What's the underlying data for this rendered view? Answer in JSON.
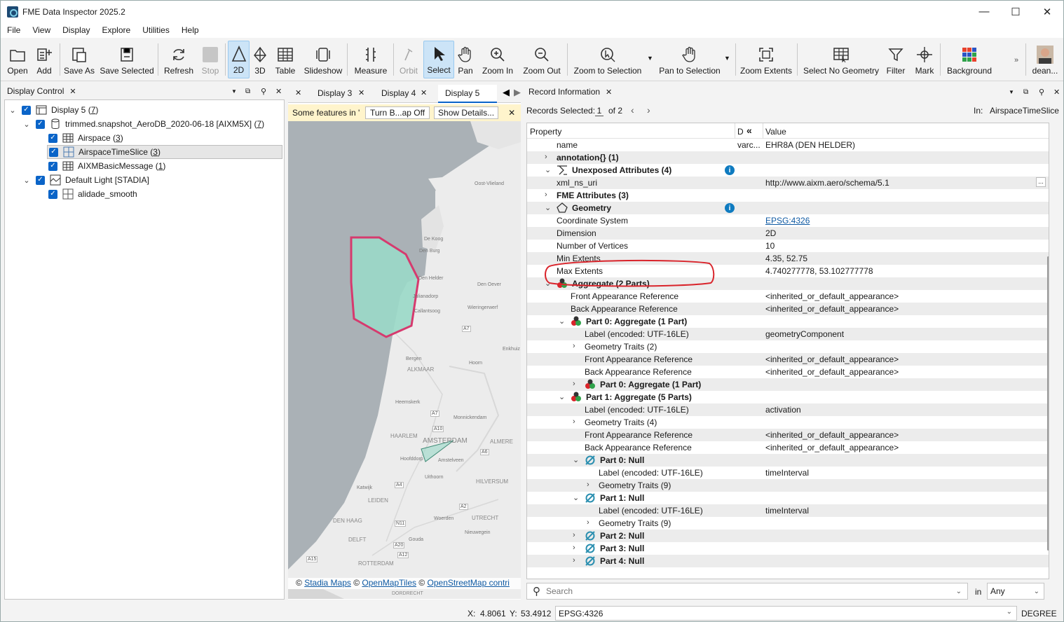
{
  "window": {
    "title": "FME Data Inspector 2025.2",
    "min": "—",
    "max": "☐",
    "close": "✕"
  },
  "menu": [
    "File",
    "View",
    "Display",
    "Explore",
    "Utilities",
    "Help"
  ],
  "toolbar": {
    "open": "Open",
    "add": "Add",
    "save_as": "Save As",
    "save_selected": "Save Selected",
    "refresh": "Refresh",
    "stop": "Stop",
    "two_d": "2D",
    "three_d": "3D",
    "table": "Table",
    "slideshow": "Slideshow",
    "measure": "Measure",
    "orbit": "Orbit",
    "select": "Select",
    "pan": "Pan",
    "zoom_in": "Zoom In",
    "zoom_out": "Zoom Out",
    "zoom_to_selection": "Zoom to Selection",
    "pan_to_selection": "Pan to Selection",
    "zoom_extents": "Zoom Extents",
    "select_no_geometry": "Select No Geometry",
    "filter": "Filter",
    "mark": "Mark",
    "background": "Background",
    "user": "dean..."
  },
  "display_control": {
    "title": "Display Control",
    "items": [
      {
        "label": "Display 5 (",
        "count": "7",
        "suffix": ")"
      },
      {
        "label": "trimmed.snapshot_AeroDB_2020-06-18 [AIXM5X] (",
        "count": "7",
        "suffix": ")"
      },
      {
        "label": "Airspace (",
        "count": "3",
        "suffix": ")"
      },
      {
        "label": "AirspaceTimeSlice (",
        "count": "3",
        "suffix": ")"
      },
      {
        "label": "AIXMBasicMessage (",
        "count": "1",
        "suffix": ")"
      },
      {
        "label": "Default Light [STADIA]",
        "count": "",
        "suffix": ""
      },
      {
        "label": "alidade_smooth",
        "count": "",
        "suffix": ""
      }
    ]
  },
  "map_panel": {
    "tabs": [
      "Display 3",
      "Display 4",
      "Display 5"
    ],
    "notice": "Some features in '",
    "turn_off": "Turn B...ap Off",
    "show_details": "Show Details...",
    "attribution": {
      "c1": "©",
      "stadia": "Stadia Maps",
      "c2": "©",
      "omt": "OpenMapTiles",
      "c3": "©",
      "osm": "OpenStreetMap contri"
    },
    "places": [
      "Oost-Vlieland",
      "De Koog",
      "Den Burg",
      "Den Helder",
      "Den Oever",
      "Julianadorp",
      "Callantsoog",
      "Wieringerwerf",
      "A7",
      "Enkhuiz",
      "Bergen",
      "ALKMAAR",
      "Hoorn",
      "Heemskerk",
      "A7",
      "Monnickendam",
      "A10",
      "HAARLEM",
      "AMSTERDAM",
      "ALMERE",
      "Hoofddorp",
      "Amstelveen",
      "A6",
      "Uithoorn",
      "A4",
      "Katwijk",
      "LEIDEN",
      "HILVERSUM",
      "A2",
      "DEN HAAG",
      "N11",
      "UTRECHT",
      "Woerden",
      "Nieuwegein",
      "DELFT",
      "A20",
      "Gouda",
      "A15",
      "A12",
      "ROTTERDAM",
      "DORDRECHT"
    ]
  },
  "record_info": {
    "title": "Record Information",
    "records_selected_label": "Records Selected:",
    "records_selected_value": "1",
    "of_total": "of 2",
    "in_label": "In:",
    "in_value": "AirspaceTimeSlice",
    "col_property": "Property",
    "col_d": "D",
    "col_value": "Value",
    "rows": [
      {
        "indent": 0,
        "exp": "",
        "icon": "",
        "label": "name",
        "d": "varc...",
        "value": "EHR8A (DEN HELDER)",
        "bold": false
      },
      {
        "indent": 0,
        "exp": ">",
        "icon": "",
        "label": "annotation{} (1)",
        "d": "",
        "value": "",
        "bold": true
      },
      {
        "indent": 0,
        "exp": "v",
        "icon": "attrs",
        "label": "Unexposed Attributes (4)",
        "d": "",
        "value": "",
        "bold": true,
        "info": true
      },
      {
        "indent": 0,
        "exp": "",
        "icon": "",
        "label": "xml_ns_uri",
        "d": "",
        "value": "http://www.aixm.aero/schema/5.1",
        "bold": false,
        "more": true
      },
      {
        "indent": 0,
        "exp": ">",
        "icon": "",
        "label": "FME Attributes (3)",
        "d": "",
        "value": "",
        "bold": true
      },
      {
        "indent": 0,
        "exp": "v",
        "icon": "geom",
        "label": "Geometry",
        "d": "",
        "value": "",
        "bold": true,
        "info": true
      },
      {
        "indent": 0,
        "exp": "",
        "icon": "",
        "label": "Coordinate System",
        "d": "",
        "value": "EPSG:4326",
        "bold": false,
        "link": true
      },
      {
        "indent": 0,
        "exp": "",
        "icon": "",
        "label": "Dimension",
        "d": "",
        "value": "2D",
        "bold": false
      },
      {
        "indent": 0,
        "exp": "",
        "icon": "",
        "label": "Number of Vertices",
        "d": "",
        "value": "10",
        "bold": false
      },
      {
        "indent": 0,
        "exp": "",
        "icon": "",
        "label": "Min Extents",
        "d": "",
        "value": "4.35, 52.75",
        "bold": false
      },
      {
        "indent": 0,
        "exp": "",
        "icon": "",
        "label": "Max Extents",
        "d": "",
        "value": "4.740277778, 53.102777778",
        "bold": false
      },
      {
        "indent": 0,
        "exp": "v",
        "icon": "agg",
        "label": "Aggregate (2 Parts)",
        "d": "",
        "value": "",
        "bold": true
      },
      {
        "indent": 1,
        "exp": "",
        "icon": "",
        "label": "Front Appearance Reference",
        "d": "",
        "value": "<inherited_or_default_appearance>",
        "bold": false
      },
      {
        "indent": 1,
        "exp": "",
        "icon": "",
        "label": "Back Appearance Reference",
        "d": "",
        "value": "<inherited_or_default_appearance>",
        "bold": false
      },
      {
        "indent": 1,
        "exp": "v",
        "icon": "agg",
        "label": "Part 0: Aggregate (1 Part)",
        "d": "",
        "value": "",
        "bold": true
      },
      {
        "indent": 2,
        "exp": "",
        "icon": "",
        "label": "Label (encoded: UTF-16LE)",
        "d": "",
        "value": "geometryComponent",
        "bold": false
      },
      {
        "indent": 2,
        "exp": ">",
        "icon": "",
        "label": "Geometry Traits (2)",
        "d": "",
        "value": "",
        "bold": false
      },
      {
        "indent": 2,
        "exp": "",
        "icon": "",
        "label": "Front Appearance Reference",
        "d": "",
        "value": "<inherited_or_default_appearance>",
        "bold": false
      },
      {
        "indent": 2,
        "exp": "",
        "icon": "",
        "label": "Back Appearance Reference",
        "d": "",
        "value": "<inherited_or_default_appearance>",
        "bold": false
      },
      {
        "indent": 2,
        "exp": ">",
        "icon": "agg",
        "label": "Part 0: Aggregate (1 Part)",
        "d": "",
        "value": "",
        "bold": true
      },
      {
        "indent": 1,
        "exp": "v",
        "icon": "agg",
        "label": "Part 1: Aggregate (5 Parts)",
        "d": "",
        "value": "",
        "bold": true
      },
      {
        "indent": 2,
        "exp": "",
        "icon": "",
        "label": "Label (encoded: UTF-16LE)",
        "d": "",
        "value": "activation",
        "bold": false
      },
      {
        "indent": 2,
        "exp": ">",
        "icon": "",
        "label": "Geometry Traits (4)",
        "d": "",
        "value": "",
        "bold": false
      },
      {
        "indent": 2,
        "exp": "",
        "icon": "",
        "label": "Front Appearance Reference",
        "d": "",
        "value": "<inherited_or_default_appearance>",
        "bold": false
      },
      {
        "indent": 2,
        "exp": "",
        "icon": "",
        "label": "Back Appearance Reference",
        "d": "",
        "value": "<inherited_or_default_appearance>",
        "bold": false
      },
      {
        "indent": 2,
        "exp": "v",
        "icon": "null",
        "label": "Part 0: Null",
        "d": "",
        "value": "",
        "bold": true
      },
      {
        "indent": 3,
        "exp": "",
        "icon": "",
        "label": "Label (encoded: UTF-16LE)",
        "d": "",
        "value": "timeInterval",
        "bold": false
      },
      {
        "indent": 3,
        "exp": ">",
        "icon": "",
        "label": "Geometry Traits (9)",
        "d": "",
        "value": "",
        "bold": false
      },
      {
        "indent": 2,
        "exp": "v",
        "icon": "null",
        "label": "Part 1: Null",
        "d": "",
        "value": "",
        "bold": true
      },
      {
        "indent": 3,
        "exp": "",
        "icon": "",
        "label": "Label (encoded: UTF-16LE)",
        "d": "",
        "value": "timeInterval",
        "bold": false
      },
      {
        "indent": 3,
        "exp": ">",
        "icon": "",
        "label": "Geometry Traits (9)",
        "d": "",
        "value": "",
        "bold": false
      },
      {
        "indent": 2,
        "exp": ">",
        "icon": "null",
        "label": "Part 2: Null",
        "d": "",
        "value": "",
        "bold": true
      },
      {
        "indent": 2,
        "exp": ">",
        "icon": "null",
        "label": "Part 3: Null",
        "d": "",
        "value": "",
        "bold": true
      },
      {
        "indent": 2,
        "exp": ">",
        "icon": "null",
        "label": "Part 4: Null",
        "d": "",
        "value": "",
        "bold": true
      }
    ],
    "search_placeholder": "Search",
    "in_word": "in",
    "any": "Any"
  },
  "status": {
    "x_label": "X:",
    "x": "4.8061",
    "y_label": "Y:",
    "y": "53.4912",
    "crs": "EPSG:4326",
    "units": "DEGREE"
  },
  "colors": {
    "accent": "#0a64c8",
    "highlight_circle": "#d9242b",
    "polygon_stroke": "#d63a6e",
    "polygon_fill": "#9ad9c8"
  }
}
